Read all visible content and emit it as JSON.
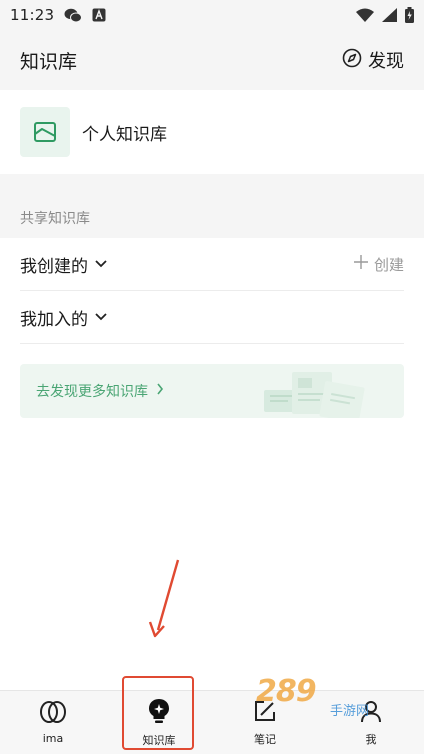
{
  "status_bar": {
    "time": "11:23",
    "left_icons": [
      "wechat-icon",
      "app-notification-icon"
    ],
    "right_icons": [
      "wifi-icon",
      "cellular-icon",
      "battery-icon"
    ]
  },
  "header": {
    "title": "知识库",
    "discover_label": "发现"
  },
  "personal": {
    "label": "个人知识库"
  },
  "shared": {
    "section_label": "共享知识库",
    "created_label": "我创建的",
    "create_label": "创建",
    "joined_label": "我加入的",
    "banner_text": "去发现更多知识库"
  },
  "tabs": [
    {
      "label": "ima",
      "icon": "ima-logo-icon"
    },
    {
      "label": "知识库",
      "icon": "knowledge-base-icon",
      "active": true
    },
    {
      "label": "笔记",
      "icon": "note-edit-icon"
    },
    {
      "label": "我",
      "icon": "profile-icon"
    }
  ],
  "watermark": {
    "text": "289",
    "sub": "手游网"
  },
  "colors": {
    "accent_green": "#4aa574",
    "annotation_red": "#e04a32",
    "background": "#f5f5f5"
  }
}
